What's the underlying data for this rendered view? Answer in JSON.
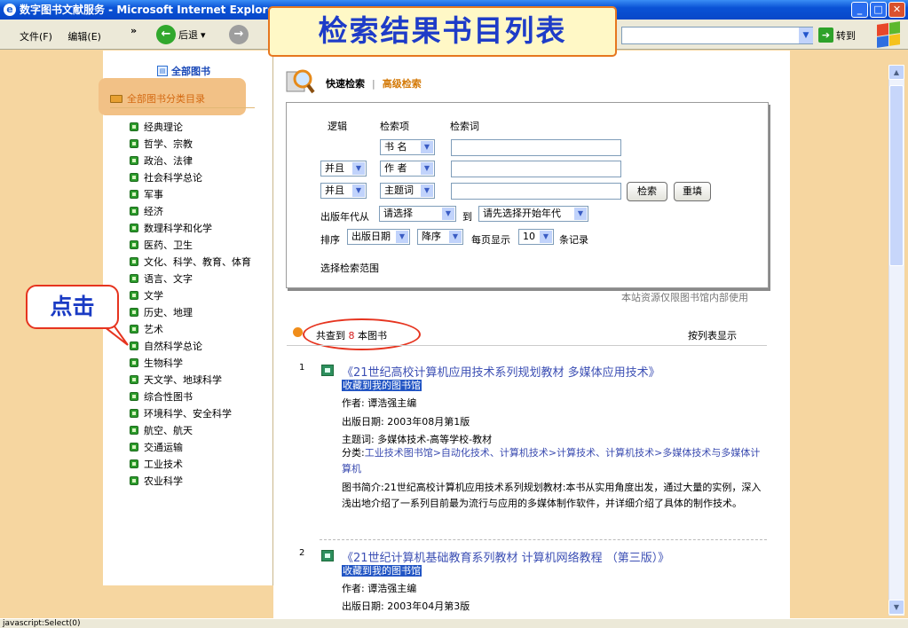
{
  "window": {
    "title": "数字图书文献服务 - Microsoft Internet Explorer"
  },
  "toolbar": {
    "menu_file": "文件(F)",
    "menu_edit": "编辑(E)",
    "chevron": "»",
    "back_label": "后退",
    "goto_label": "转到"
  },
  "callouts": {
    "title": "检索结果书目列表",
    "click": "点击"
  },
  "sidebar": {
    "all_books": "全部图书",
    "category_header": "全部图书分类目录",
    "categories": [
      "经典理论",
      "哲学、宗教",
      "政治、法律",
      "社会科学总论",
      "军事",
      "经济",
      "数理科学和化学",
      "医药、卫生",
      "文化、科学、教育、体育",
      "语言、文字",
      "文学",
      "历史、地理",
      "艺术",
      "自然科学总论",
      "生物科学",
      "天文学、地球科学",
      "综合性图书",
      "环境科学、安全科学",
      "航空、航天",
      "交通运输",
      "工业技术",
      "农业科学"
    ]
  },
  "search": {
    "tab_quick": "快速检索",
    "tab_sep": "|",
    "tab_advanced": "高级检索",
    "header_logic": "逻辑",
    "header_field": "检索项",
    "header_term": "检索词",
    "rows": [
      {
        "logic": "",
        "field": "书 名"
      },
      {
        "logic": "并且",
        "field": "作 者"
      },
      {
        "logic": "并且",
        "field": "主题词"
      }
    ],
    "search_button": "检索",
    "reset_button": "重填",
    "year_from_label": "出版年代从",
    "year_from_value": "请选择",
    "year_to_label": "到",
    "year_to_value": "请先选择开始年代",
    "sort_label": "排序",
    "sort_field": "出版日期",
    "sort_order": "降序",
    "per_page_label": "每页显示",
    "per_page_value": "10",
    "records_label": "条记录",
    "scope_label": "选择检索范围",
    "usage_note": "本站资源仅限图书馆内部使用"
  },
  "results": {
    "count_prefix": "共查到",
    "count": "8",
    "count_suffix": "本图书",
    "list_view": "按列表显示",
    "fav_label": "收藏到我的图书馆",
    "items": [
      {
        "index": "1",
        "title": "《21世纪高校计算机应用技术系列规划教材 多媒体应用技术》",
        "author": "作者: 谭浩强主编",
        "date": "出版日期: 2003年08月第1版",
        "subject": "主题词: 多媒体技术-高等学校-教材",
        "class_label": "分类:",
        "class_value": "工业技术图书馆>自动化技术、计算机技术>计算技术、计算机技术>多媒体技术与多媒体计算机",
        "desc": "图书简介:21世纪高校计算机应用技术系列规划教材:本书从实用角度出发，通过大量的实例，深入浅出地介绍了一系列目前最为流行与应用的多媒体制作软件，并详细介绍了具体的制作技术。"
      },
      {
        "index": "2",
        "title": "《21世纪计算机基础教育系列教材 计算机网络教程 （第三版）》",
        "author": "作者: 谭浩强主编",
        "date": "出版日期: 2003年04月第3版"
      }
    ]
  },
  "status": {
    "text": "javascript:Select(0)"
  },
  "colors": {
    "title_bar": "#0a52d6",
    "page_bg": "#f6d6a0",
    "callout_border": "#e6341f",
    "link_blue": "#3c4fb4",
    "highlight": "#2255c4"
  }
}
